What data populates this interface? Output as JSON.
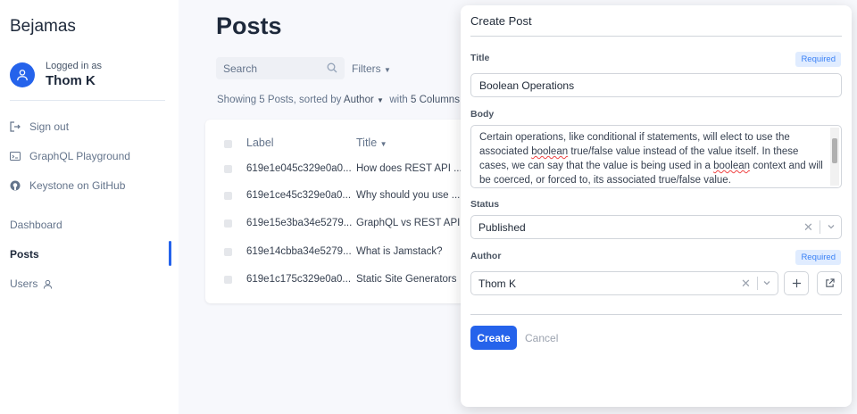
{
  "sidebar": {
    "brand": "Bejamas",
    "logged_in_as": "Logged in as",
    "user_name": "Thom K",
    "links": [
      {
        "label": "Sign out",
        "icon": "sign-out-icon"
      },
      {
        "label": "GraphQL Playground",
        "icon": "terminal-icon"
      },
      {
        "label": "Keystone on GitHub",
        "icon": "github-icon"
      }
    ],
    "nav": [
      {
        "label": "Dashboard"
      },
      {
        "label": "Posts"
      },
      {
        "label": "Users",
        "icon": "user-icon"
      }
    ]
  },
  "main": {
    "title": "Posts",
    "search_placeholder": "Search",
    "filters_label": "Filters",
    "showing_prefix": "Showing 5 Posts, sorted by",
    "sort_field": "Author",
    "with_label": "with",
    "columns_label": "5 Columns",
    "table": {
      "headers": {
        "label": "Label",
        "title": "Title"
      },
      "rows": [
        {
          "label": "619e1e045c329e0a0...",
          "title": "How does REST API ..."
        },
        {
          "label": "619e1ce45c329e0a0...",
          "title": "Why should you use ..."
        },
        {
          "label": "619e15e3ba34e5279...",
          "title": "GraphQL vs REST API"
        },
        {
          "label": "619e14cbba34e5279...",
          "title": "What is Jamstack?"
        },
        {
          "label": "619e1c175c329e0a0...",
          "title": "Static Site Generators"
        }
      ]
    }
  },
  "dialog": {
    "title": "Create Post",
    "title_label": "Title",
    "required_label": "Required",
    "title_value": "Boolean Operations",
    "body_label": "Body",
    "body_text_1": "Certain operations, like conditional if statements, will elect to use the associated ",
    "body_word_1": "boolean",
    "body_text_2": " true/false value instead of the value itself. In these cases, we can say that the value is being used in a ",
    "body_word_2": "boolean",
    "body_text_3": " context and will be coerced, or forced to, its associated true/false value.",
    "status_label": "Status",
    "status_value": "Published",
    "author_label": "Author",
    "author_value": "Thom K",
    "create_label": "Create",
    "cancel_label": "Cancel"
  },
  "colors": {
    "accent": "#2563eb",
    "required_bg": "#e0ecff",
    "page_bg": "#f7f8fc"
  }
}
